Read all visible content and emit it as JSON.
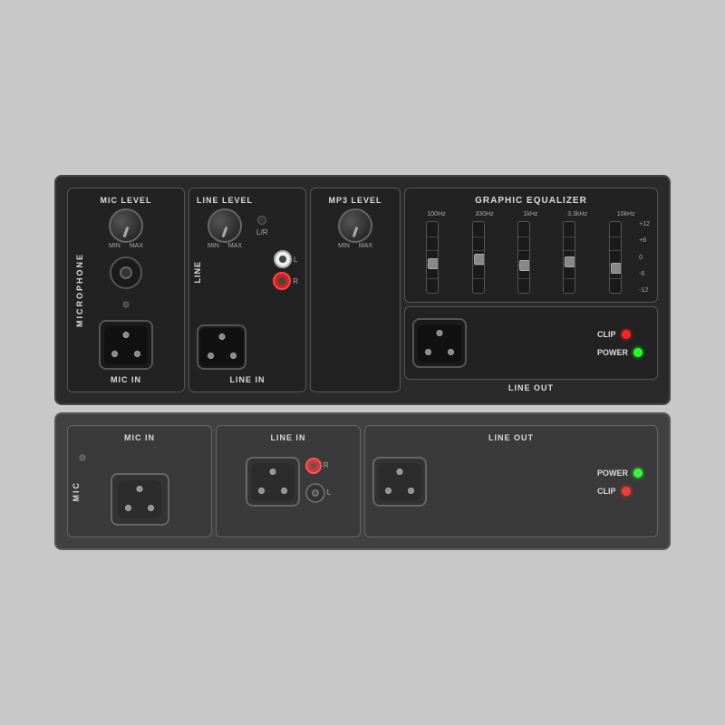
{
  "top_panel": {
    "mic": {
      "level_label": "MIC LEVEL",
      "section_label": "MICROPHONE",
      "min_label": "MIN",
      "max_label": "MAX",
      "bottom_label": "MIC IN"
    },
    "line": {
      "level_label": "LINE LEVEL",
      "section_label": "LINE",
      "min_label": "MIN",
      "max_label": "MAX",
      "lr_label": "L/R",
      "rca_l": "L",
      "rca_r": "R",
      "bottom_label": "LINE IN"
    },
    "mp3": {
      "level_label": "MP3 LEVEL",
      "min_label": "MIN",
      "max_label": "MAX"
    },
    "eq": {
      "title": "GRAPHIC EQUALIZER",
      "freq_labels": [
        "100Hz",
        "330Hz",
        "1kHz",
        "3.3kHz",
        "10kHz"
      ],
      "db_labels": [
        "+12",
        "+6",
        "0",
        "-6",
        "-12"
      ],
      "slider_positions": [
        40,
        35,
        42,
        38,
        45
      ]
    },
    "lineout": {
      "title": "LINE OUT",
      "clip_label": "CLIP",
      "power_label": "POWER"
    }
  },
  "bottom_panel": {
    "mic": {
      "label": "MIC IN"
    },
    "line": {
      "label": "LINE IN",
      "rca_r": "R",
      "rca_l": "L"
    },
    "lineout": {
      "label": "LINE OUT",
      "power_label": "POWER",
      "clip_label": "CLIP"
    }
  }
}
